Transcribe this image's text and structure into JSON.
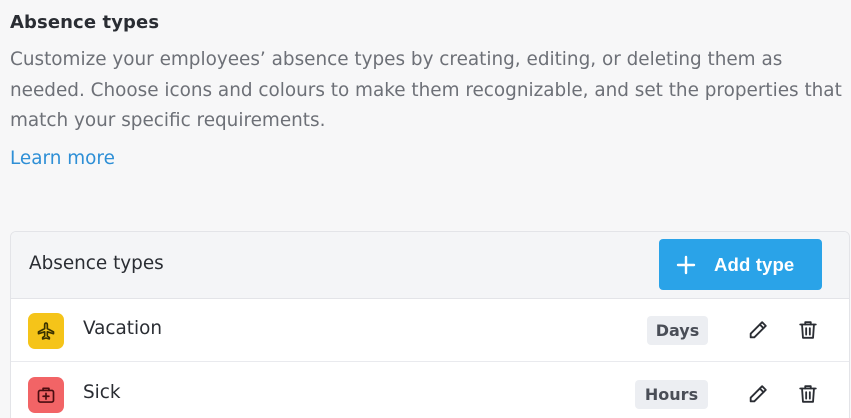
{
  "section": {
    "title": "Absence types",
    "description": "Customize your employees’ absence types by creating, editing, or deleting them as needed. Choose icons and colours to make them recognizable, and set the properties that match your specific requirements.",
    "learn_more": "Learn more"
  },
  "card": {
    "title": "Absence types",
    "add_button": {
      "label": "Add type",
      "icon": "plus-icon"
    }
  },
  "absence_types": [
    {
      "name": "Vacation",
      "unit": "Days",
      "icon": "airplane-icon",
      "color": "#f5c419",
      "icon_color": "#3a3200"
    },
    {
      "name": "Sick",
      "unit": "Hours",
      "icon": "medical-kit-icon",
      "color": "#f26466",
      "icon_color": "#4a0d10"
    }
  ],
  "colors": {
    "accent": "#2aa3e8",
    "link": "#2e8fd6",
    "background": "#f7f7f8"
  }
}
